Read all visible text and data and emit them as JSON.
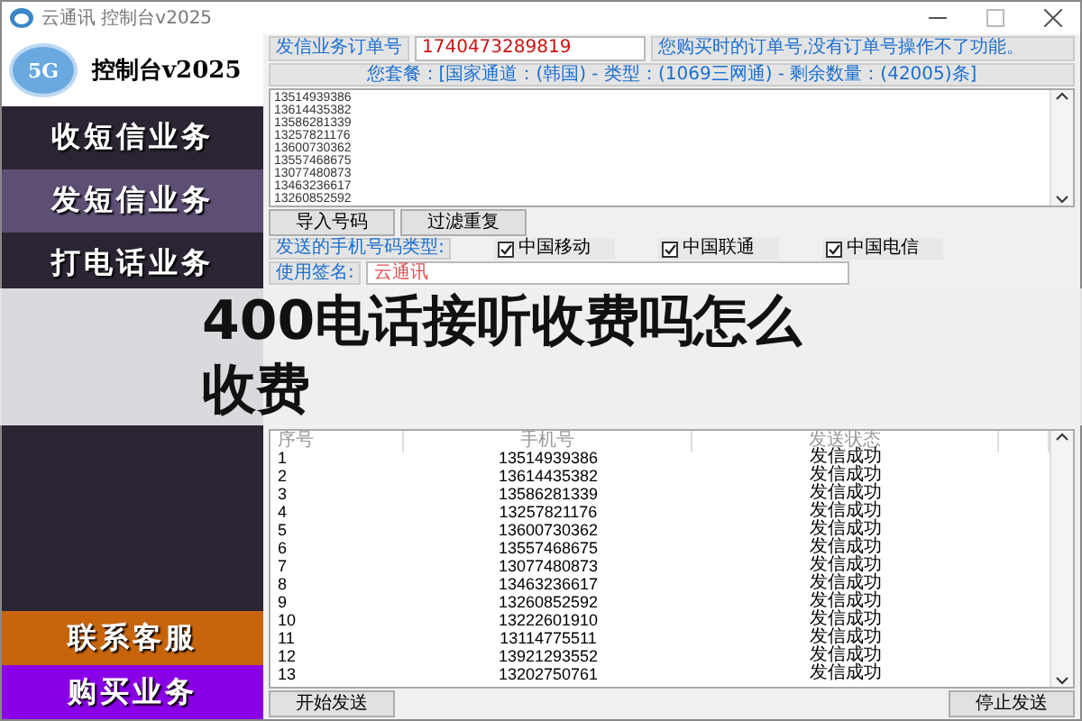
{
  "window": {
    "title": "云通讯 控制台v2025"
  },
  "logo": {
    "badge": "5G",
    "title": "控制台v2025"
  },
  "sidebar": {
    "items": [
      {
        "label": "收短信业务",
        "selected": false
      },
      {
        "label": "发短信业务",
        "selected": true
      },
      {
        "label": "打电话业务",
        "selected": false
      }
    ],
    "bottom_items": [
      {
        "label": "联系客服",
        "color": "#c8650c"
      },
      {
        "label": "购买业务",
        "color": "#8a00e6"
      }
    ]
  },
  "order": {
    "label": "发信业务订单号",
    "value": "1740473289819",
    "note": "您购买时的订单号,没有订单号操作不了功能。"
  },
  "package_info": "您套餐：[国家通道：(韩国) - 类型：(1069三网通) - 剩余数量：(42005)条]",
  "numbers_box": {
    "lines": [
      "13514939386",
      "13614435382",
      "13586281339",
      "13257821176",
      "13600730362",
      "13557468675",
      "13077480873",
      "13463236617",
      "13260852592"
    ]
  },
  "buttons": [
    "导入号码",
    "过滤重复"
  ],
  "carrier_type": {
    "label": "发送的手机号码类型:",
    "options": [
      {
        "label": "中国移动",
        "checked": true
      },
      {
        "label": "中国联通",
        "checked": true
      },
      {
        "label": "中国电信",
        "checked": true
      }
    ]
  },
  "signature": {
    "label": "使用签名:",
    "value": "云通讯"
  },
  "table": {
    "columns": [
      "序号",
      "手机号",
      "发送状态"
    ],
    "rows": [
      [
        "1",
        "13514939386",
        "发信成功"
      ],
      [
        "2",
        "13614435382",
        "发信成功"
      ],
      [
        "3",
        "13586281339",
        "发信成功"
      ],
      [
        "4",
        "13257821176",
        "发信成功"
      ],
      [
        "5",
        "13600730362",
        "发信成功"
      ],
      [
        "6",
        "13557468675",
        "发信成功"
      ],
      [
        "7",
        "13077480873",
        "发信成功"
      ],
      [
        "8",
        "13463236617",
        "发信成功"
      ],
      [
        "9",
        "13260852592",
        "发信成功"
      ],
      [
        "10",
        "13222601910",
        "发信成功"
      ],
      [
        "11",
        "13114775511",
        "发信成功"
      ],
      [
        "12",
        "13921293552",
        "发信成功"
      ],
      [
        "13",
        "13202750761",
        "发信成功"
      ]
    ]
  },
  "footer_buttons": [
    "开始发送",
    "停止发送"
  ],
  "overlay_title": {
    "lines": [
      "400电话接听收费吗怎么",
      "收费"
    ]
  }
}
